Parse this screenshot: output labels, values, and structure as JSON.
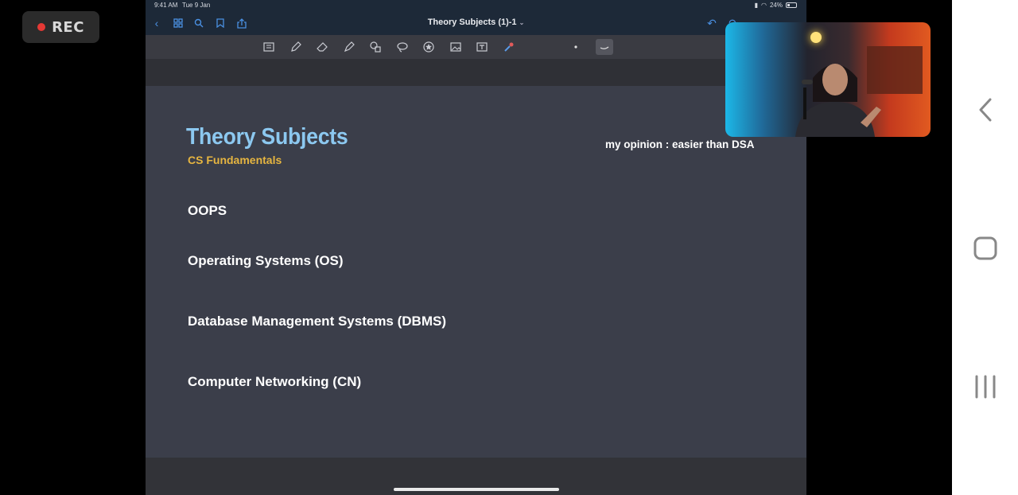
{
  "recorder": {
    "label": "REC"
  },
  "status_bar": {
    "time": "9:41 AM",
    "date": "Tue 9 Jan",
    "battery": "24%"
  },
  "nav": {
    "doc_title": "Theory Subjects (1)-1"
  },
  "toolbar": {
    "tools": [
      "reader-mode-icon",
      "pen-icon",
      "eraser-icon",
      "highlighter-icon",
      "shapes-icon",
      "lasso-icon",
      "elements-icon",
      "image-icon",
      "text-icon",
      "laser-pointer-icon"
    ]
  },
  "page": {
    "title": "Theory Subjects",
    "subtitle": "CS Fundamentals",
    "note": "my opinion : easier than DSA",
    "subjects": [
      "OOPS",
      "Operating Systems (OS)",
      "Database Management Systems (DBMS)",
      "Computer Networking (CN)"
    ]
  },
  "colors": {
    "title": "#8cc8f0",
    "subtitle": "#e6b540",
    "page_bg": "#3b3e4a",
    "accent": "#4a90e2"
  }
}
